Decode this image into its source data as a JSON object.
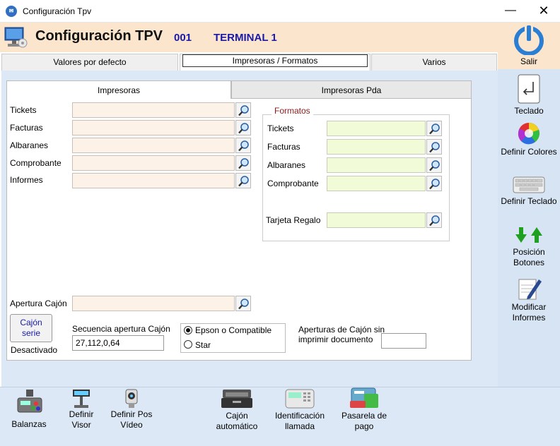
{
  "window": {
    "title": "Configuración Tpv",
    "minimize": "—",
    "close": "✕"
  },
  "header": {
    "title": "Configuración TPV",
    "terminal_code": "001",
    "terminal_name": "TERMINAL 1"
  },
  "outer_tabs": [
    "Valores por defecto",
    "Impresoras / Formatos",
    "Varios"
  ],
  "inner_tabs": [
    "Impresoras",
    "Impresoras Pda"
  ],
  "printers": {
    "tickets": {
      "label": "Tickets",
      "value": ""
    },
    "facturas": {
      "label": "Facturas",
      "value": ""
    },
    "albaranes": {
      "label": "Albaranes",
      "value": ""
    },
    "comprobante": {
      "label": "Comprobante",
      "value": ""
    },
    "informes": {
      "label": "Informes",
      "value": ""
    }
  },
  "formatos": {
    "title": "Formatos",
    "tickets": {
      "label": "Tickets",
      "value": ""
    },
    "facturas": {
      "label": "Facturas",
      "value": ""
    },
    "albaranes": {
      "label": "Albaranes",
      "value": ""
    },
    "comprobante": {
      "label": "Comprobante",
      "value": ""
    },
    "tarjeta": {
      "label": "Tarjeta Regalo",
      "value": ""
    }
  },
  "cajon": {
    "apertura_label": "Apertura Cajón",
    "apertura_value": "",
    "serie_button": "Cajón serie",
    "serie_status": "Desactivado",
    "secuencia_label": "Secuencia apertura Cajón",
    "secuencia_value": "27,112,0,64",
    "radio_epson": "Epson o Compatible",
    "radio_star": "Star",
    "selected": "epson",
    "sin_imprimir_label": "Aperturas de Cajón sin imprimir documento",
    "sin_imprimir_value": ""
  },
  "sidebar": {
    "salir": "Salir",
    "teclado": "Teclado",
    "definir_colores": "Definir Colores",
    "definir_teclado": "Definir Teclado",
    "posicion_botones": "Posición Botones",
    "modificar_informes": "Modificar Informes"
  },
  "bottom": {
    "balanzas": "Balanzas",
    "definir_visor": "Definir Visor",
    "definir_pos_video": "Definir Pos Vídeo",
    "cajon_automatico": "Cajón automático",
    "identificacion_llamada": "Identificación llamada",
    "pasarela_pago": "Pasarela de pago"
  },
  "colors": {
    "header_bg": "#fbe6cd",
    "accent_blue": "#1a1aa8",
    "formatos_title": "#8b1a1a",
    "field_bg": "#fdf2e8",
    "field_green": "#f2fbd8",
    "panel_bg": "#dce8f5"
  }
}
